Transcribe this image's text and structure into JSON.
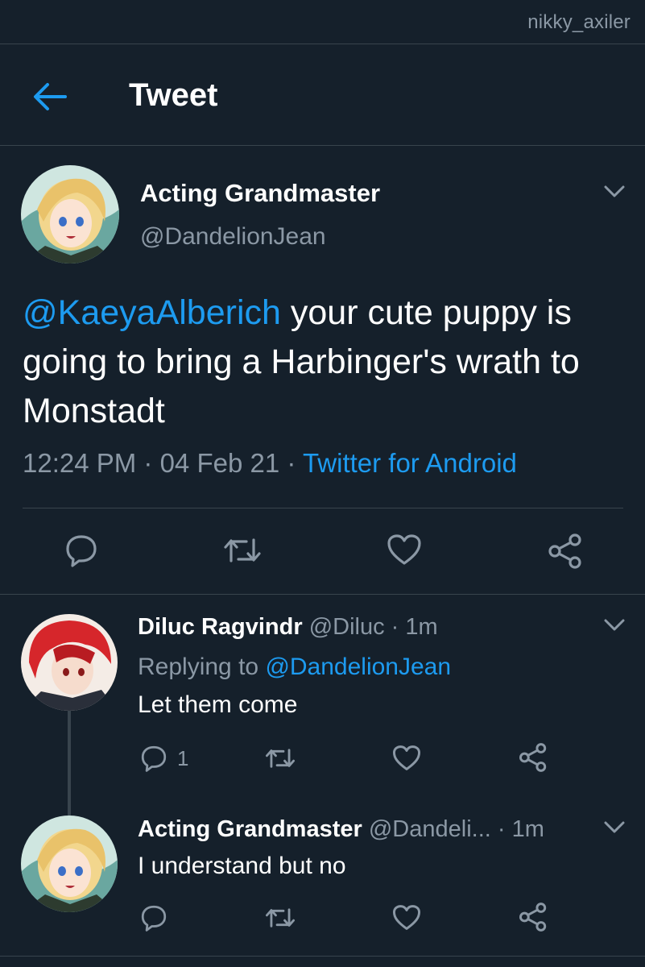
{
  "watermark": "nikky_axiler",
  "header": {
    "title": "Tweet"
  },
  "main_tweet": {
    "name": "Acting Grandmaster",
    "handle": "@DandelionJean",
    "text_mention": "@KaeyaAlberich",
    "text_rest": " your cute puppy is going to bring a Harbinger's wrath to Monstadt",
    "time": "12:24 PM",
    "date": "04 Feb 21",
    "separator": " · ",
    "source": "Twitter for Android"
  },
  "replies": [
    {
      "name": "Diluc Ragvindr",
      "handle": "@Diluc",
      "time": "1m",
      "replying_label": "Replying to ",
      "replying_to": "@DandelionJean",
      "text": "Let them come",
      "reply_count": "1"
    },
    {
      "name": "Acting Grandmaster",
      "handle": "@Dandeli...",
      "time": "1m",
      "text": "I understand but no"
    }
  ],
  "icons": {
    "back": "arrow-left-icon",
    "more": "chevron-down-icon",
    "reply": "speech-bubble-icon",
    "retweet": "retweet-icon",
    "like": "heart-icon",
    "share": "share-icon"
  },
  "colors": {
    "background": "#15202b",
    "accent": "#1d9bf0",
    "secondary_text": "#8b98a5",
    "divider": "#38444d"
  }
}
